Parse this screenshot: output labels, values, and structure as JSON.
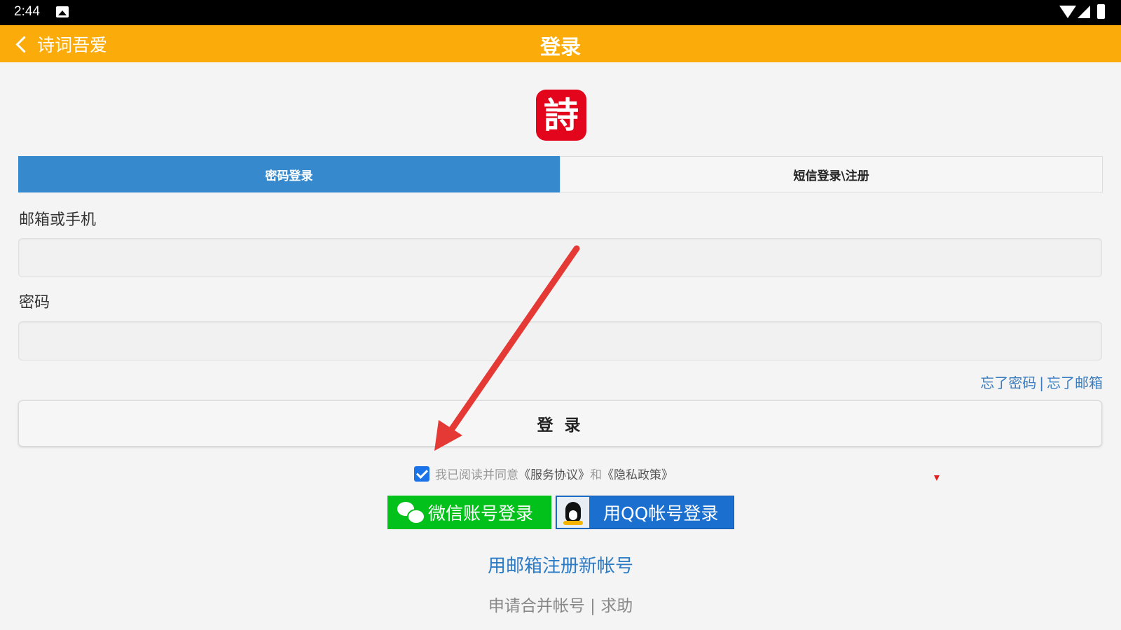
{
  "status_bar": {
    "time": "2:44"
  },
  "app_bar": {
    "back_label": "诗词吾爱",
    "title": "登录"
  },
  "logo": {
    "char": "詩",
    "color": "#e3051b"
  },
  "tabs": [
    {
      "label": "密码登录",
      "active": true
    },
    {
      "label": "短信登录\\注册",
      "active": false
    }
  ],
  "form": {
    "account_label": "邮箱或手机",
    "account_value": "",
    "password_label": "密码",
    "password_value": "",
    "forgot_password": "忘了密码",
    "forgot_separator": "|",
    "forgot_email": "忘了邮箱",
    "login_button": "登 录"
  },
  "agreement": {
    "checked": true,
    "prefix": "我已阅读并同意",
    "service": "《服务协议》",
    "and": "和",
    "privacy": "《隐私政策》"
  },
  "social": {
    "wechat_label": "微信账号登录",
    "qq_label": "用QQ帐号登录"
  },
  "footer": {
    "register": "用邮箱注册新帐号",
    "merge": "申请合并帐号",
    "separator": "|",
    "help": "求助"
  },
  "colors": {
    "app_bar": "#fbac0a",
    "tab_active": "#3589cc",
    "wechat": "#03c11b",
    "qq": "#1a6fcf",
    "annotation_arrow": "#e53935"
  }
}
